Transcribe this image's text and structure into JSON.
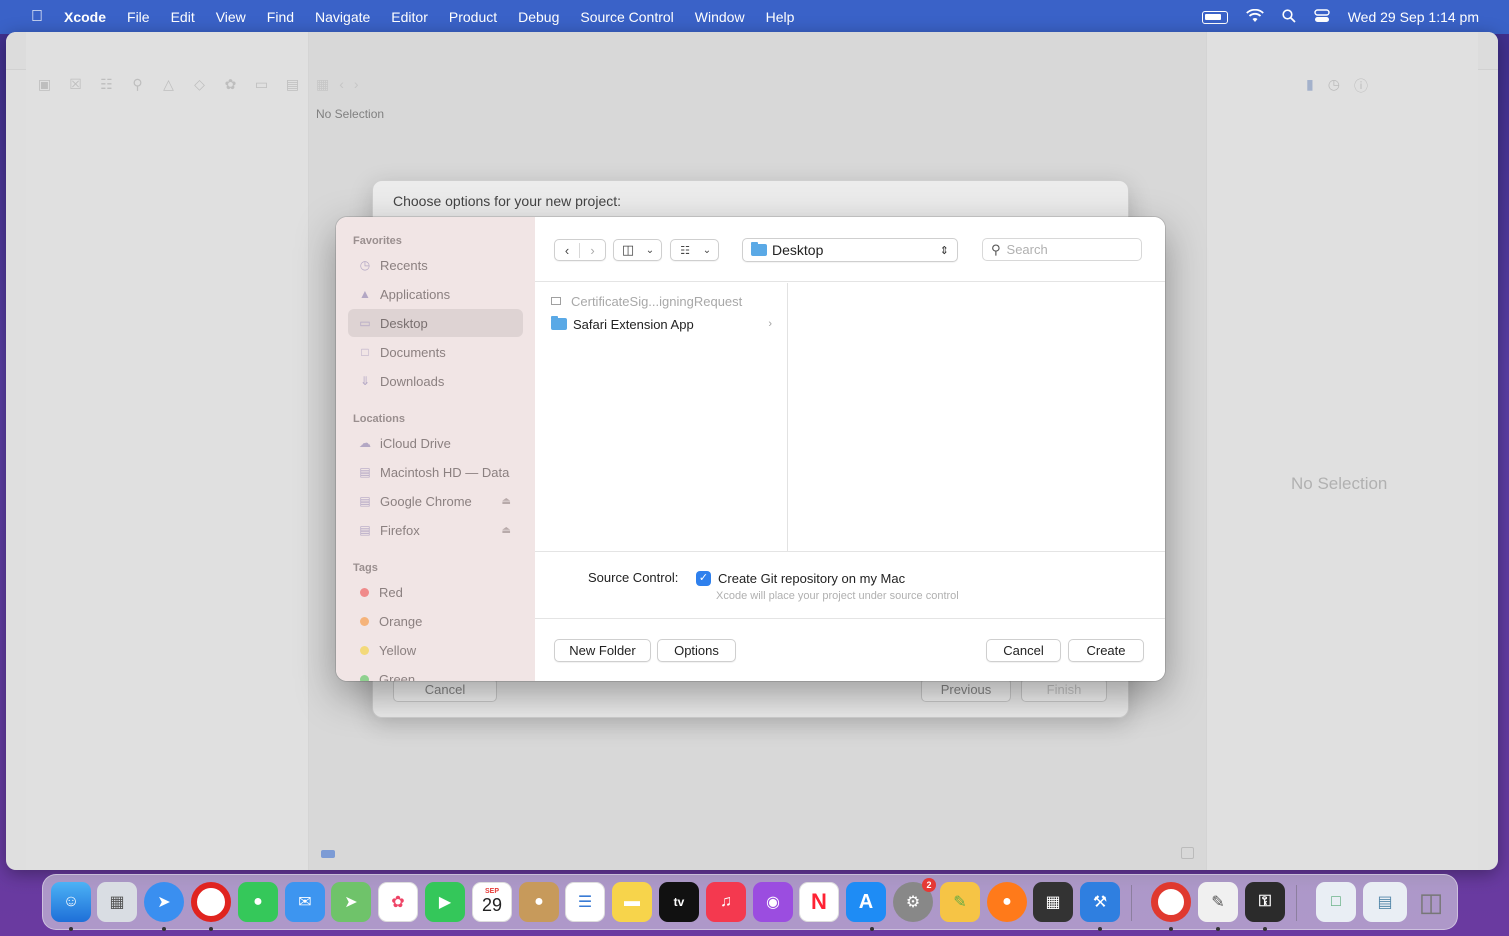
{
  "menubar": {
    "app_name": "Xcode",
    "items": [
      "File",
      "Edit",
      "View",
      "Find",
      "Navigate",
      "Editor",
      "Product",
      "Debug",
      "Source Control",
      "Window",
      "Help"
    ],
    "datetime": "Wed 29 Sep  1:14 pm"
  },
  "xcode": {
    "editor_no_selection": "No Selection",
    "inspector_no_selection": "No Selection"
  },
  "template_sheet": {
    "title": "Choose options for your new project:",
    "cancel": "Cancel",
    "previous": "Previous",
    "finish": "Finish"
  },
  "save_panel": {
    "sidebar": {
      "favorites_header": "Favorites",
      "favorites": [
        {
          "label": "Recents",
          "icon": "clock-icon"
        },
        {
          "label": "Applications",
          "icon": "applications-icon"
        },
        {
          "label": "Desktop",
          "icon": "desktop-icon",
          "selected": true
        },
        {
          "label": "Documents",
          "icon": "document-icon"
        },
        {
          "label": "Downloads",
          "icon": "download-icon"
        }
      ],
      "locations_header": "Locations",
      "locations": [
        {
          "label": "iCloud Drive",
          "icon": "cloud-icon"
        },
        {
          "label": "Macintosh HD — Data",
          "icon": "disk-icon"
        },
        {
          "label": "Google Chrome",
          "icon": "disk-icon",
          "ejectable": true
        },
        {
          "label": "Firefox",
          "icon": "disk-icon",
          "ejectable": true
        }
      ],
      "tags_header": "Tags",
      "tags": [
        {
          "label": "Red",
          "color": "#f08a8a"
        },
        {
          "label": "Orange",
          "color": "#f5b37a"
        },
        {
          "label": "Yellow",
          "color": "#f3d97a"
        },
        {
          "label": "Green",
          "color": "#8fd18f"
        }
      ]
    },
    "path_popup": "Desktop",
    "search_placeholder": "Search",
    "files": [
      {
        "name": "CertificateSig...igningRequest",
        "dimmed": true
      },
      {
        "name": "Safari Extension App",
        "folder": true
      }
    ],
    "source_control_label": "Source Control:",
    "git_checkbox_label": "Create Git repository on my Mac",
    "git_checked": true,
    "git_hint": "Xcode will place your project under source control",
    "new_folder": "New Folder",
    "options": "Options",
    "cancel": "Cancel",
    "create": "Create"
  },
  "dock": {
    "calendar_month": "SEP",
    "calendar_day": "29",
    "settings_badge": "2"
  },
  "colors": {
    "menubar": "#3a62c8",
    "accent": "#2f80ed",
    "sidebar_bg": "#f1e5e5"
  }
}
